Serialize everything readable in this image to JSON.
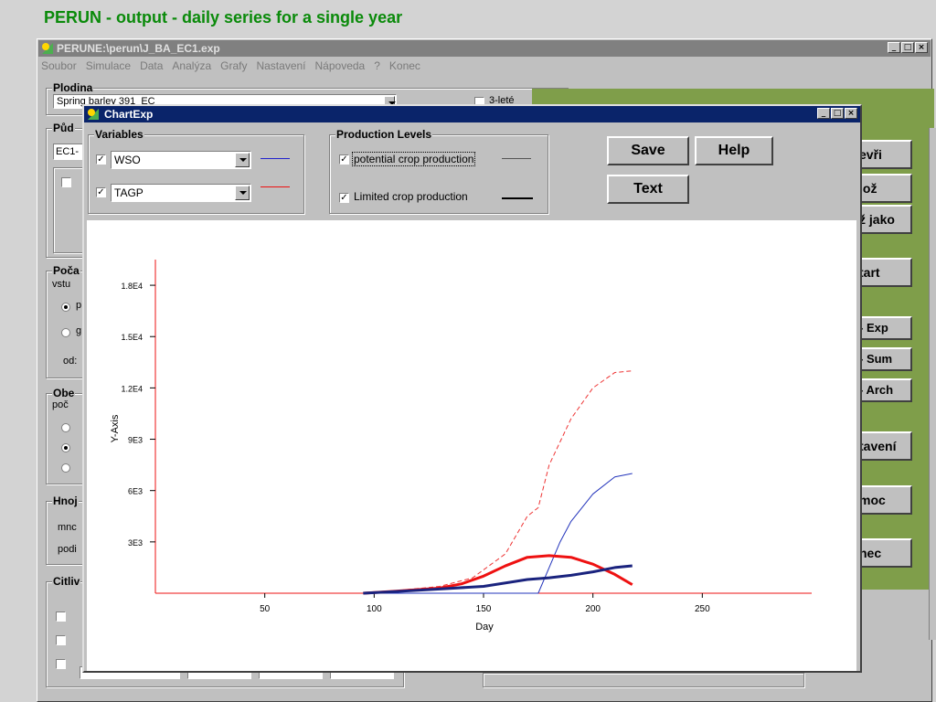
{
  "slide_title": "PERUN - output - daily series for a single year",
  "main_window": {
    "title": "PERUNE:\\perun\\J_BA_EC1.exp",
    "menu": [
      "Soubor",
      "Simulace",
      "Data",
      "Analýza",
      "Grafy",
      "Nastavení",
      "Nápoveda",
      "?",
      "Konec"
    ],
    "plodina_label": "Plodina",
    "plodina_value": "Spring barley 391_EC",
    "option_3lete": "3-leté",
    "pudy_label": "Půd",
    "pudy_value": "EC1-",
    "poca_label": "Poča",
    "vstu_label": "vstu",
    "radio_a": "p",
    "radio_b": "g",
    "od_label": "od:",
    "obe_label": "Obe",
    "poc_label": "poč",
    "hnoj_label": "Hnoj",
    "mnc_label": "mnc",
    "podi_label": "podi",
    "citl_label": "Citliv",
    "right_buttons": [
      "evři",
      "lož",
      "ž jako",
      "tart",
      "- Exp",
      "- Sum",
      "- Arch",
      "tavení",
      "moc",
      "nec"
    ]
  },
  "dialog": {
    "title": "ChartExp",
    "variables_label": "Variables",
    "var1": "WSO",
    "var2": "TAGP",
    "var1_checked": true,
    "var2_checked": true,
    "var1_color": "#2222cc",
    "var2_color": "#ee1111",
    "levels_label": "Production Levels",
    "level1": "potential crop production",
    "level2": "Limited crop production",
    "save": "Save",
    "help": "Help",
    "text": "Text"
  },
  "chart_data": {
    "type": "line",
    "xlabel": "Day",
    "ylabel": "Y-Axis",
    "x_ticks": [
      50,
      100,
      150,
      200,
      250
    ],
    "y_ticks": [
      "3E3",
      "6E3",
      "9E3",
      "1.2E4",
      "1.5E4",
      "1.8E4"
    ],
    "y_tick_values": [
      3000,
      6000,
      9000,
      12000,
      15000,
      18000
    ],
    "xlim": [
      0,
      300
    ],
    "ylim": [
      0,
      19500
    ],
    "series": [
      {
        "color": "#ee3333",
        "style": "dashed-thin",
        "x": [
          95,
          110,
          130,
          145,
          160,
          170,
          175,
          180,
          190,
          200,
          210,
          218
        ],
        "y": [
          0,
          150,
          400,
          900,
          2300,
          4500,
          5000,
          7500,
          10200,
          12000,
          12900,
          13000
        ]
      },
      {
        "color": "#2233bb",
        "style": "solid-thin",
        "x": [
          95,
          170,
          175,
          180,
          185,
          190,
          200,
          210,
          218
        ],
        "y": [
          0,
          0,
          0,
          1500,
          3000,
          4200,
          5800,
          6800,
          7000
        ]
      },
      {
        "color": "#ee1111",
        "style": "solid-thick",
        "x": [
          95,
          110,
          130,
          140,
          150,
          160,
          170,
          180,
          190,
          200,
          210,
          218
        ],
        "y": [
          0,
          120,
          300,
          550,
          1000,
          1600,
          2100,
          2200,
          2100,
          1700,
          1100,
          500
        ]
      },
      {
        "color": "#1a237e",
        "style": "solid-thick",
        "x": [
          95,
          110,
          130,
          150,
          170,
          180,
          190,
          200,
          210,
          218
        ],
        "y": [
          0,
          100,
          250,
          400,
          800,
          900,
          1050,
          1250,
          1500,
          1600
        ]
      }
    ]
  }
}
